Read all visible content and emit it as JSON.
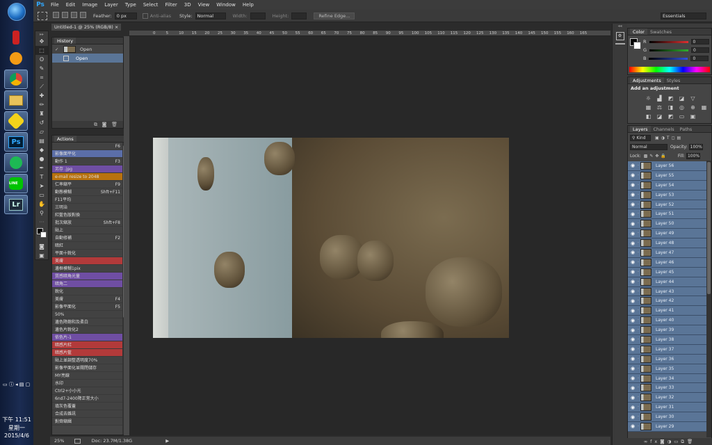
{
  "app": {
    "logo": "Ps"
  },
  "menu": [
    "File",
    "Edit",
    "Image",
    "Layer",
    "Type",
    "Select",
    "Filter",
    "3D",
    "View",
    "Window",
    "Help"
  ],
  "options": {
    "feather_label": "Feather:",
    "feather_value": "0 px",
    "antialias": "Anti-alias",
    "style_label": "Style:",
    "style_value": "Normal",
    "width_label": "Width:",
    "height_label": "Height:",
    "refine": "Refine Edge...",
    "workspace": "Essentials"
  },
  "document": {
    "tab": "Untitled-1 @ 25% (RGB/8)",
    "zoom": "25%",
    "doc_size": "Doc: 23.7M/1.38G"
  },
  "ruler_ticks": [
    "0",
    "5",
    "10",
    "15",
    "20",
    "25",
    "30",
    "35",
    "40",
    "45",
    "50",
    "55",
    "60",
    "65",
    "70",
    "75",
    "80",
    "85",
    "90",
    "95",
    "100",
    "105",
    "110",
    "115",
    "120",
    "125",
    "130",
    "135",
    "140",
    "145",
    "150",
    "155",
    "160",
    "165"
  ],
  "history": {
    "title": "History",
    "snapshot": "Open",
    "item": "Open"
  },
  "actions": {
    "title": "Actions",
    "items": [
      {
        "label": "",
        "key": "F6",
        "color": "plain"
      },
      {
        "label": "影像面平化",
        "key": "",
        "color": "blue"
      },
      {
        "label": "動作 1",
        "key": "F3",
        "color": "plain"
      },
      {
        "label": "另存 .jpg",
        "key": "",
        "color": "purple"
      },
      {
        "label": "e-mail resize to 2048",
        "key": "",
        "color": "orange"
      },
      {
        "label": "仁率縮平",
        "key": "F9",
        "color": "plain"
      },
      {
        "label": "動態模糊",
        "key": "Shft+F11",
        "color": "plain"
      },
      {
        "label": "F11平均",
        "key": "",
        "color": "plain"
      },
      {
        "label": "三明治",
        "key": "",
        "color": "plain"
      },
      {
        "label": "紅藍色版對換",
        "key": "",
        "color": "plain"
      },
      {
        "label": "批次縮放",
        "key": "Shft+F8",
        "color": "plain"
      },
      {
        "label": "貼上",
        "key": "",
        "color": "plain"
      },
      {
        "label": "自動修補",
        "key": "F2",
        "color": "plain"
      },
      {
        "label": "暗紅",
        "key": "",
        "color": "plain"
      },
      {
        "label": "平面十銳化",
        "key": "",
        "color": "plain"
      },
      {
        "label": "美膚",
        "key": "",
        "color": "red"
      },
      {
        "label": "邊框模糊1pix",
        "key": "",
        "color": "plain"
      },
      {
        "label": "質感暗角光量",
        "key": "",
        "color": "purple"
      },
      {
        "label": "暗角二",
        "key": "",
        "color": "purple"
      },
      {
        "label": "銳化",
        "key": "",
        "color": "plain"
      },
      {
        "label": "美膚",
        "key": "F4",
        "color": "plain"
      },
      {
        "label": "影像平面化",
        "key": "F5",
        "color": "plain"
      },
      {
        "label": "50%",
        "key": "",
        "color": "plain"
      },
      {
        "label": "邊色降飽和及柔白",
        "key": "",
        "color": "plain"
      },
      {
        "label": "邊色片銳化2",
        "key": "",
        "color": "plain"
      },
      {
        "label": "依色片-1",
        "key": "",
        "color": "purple"
      },
      {
        "label": "暗感片紅",
        "key": "",
        "color": "red"
      },
      {
        "label": "暗感片藍",
        "key": "",
        "color": "red"
      },
      {
        "label": "貼上並調整透明度70%",
        "key": "",
        "color": "plain"
      },
      {
        "label": "影像平面化並關閉儲存",
        "key": "",
        "color": "plain"
      },
      {
        "label": "MY亮線",
        "key": "",
        "color": "plain"
      },
      {
        "label": "水印",
        "key": "",
        "color": "plain"
      },
      {
        "label": "Ctrl2+小小光",
        "key": "",
        "color": "plain"
      },
      {
        "label": "6nd7-2400降正常大小",
        "key": "",
        "color": "plain"
      },
      {
        "label": "填灰色覆蓋",
        "key": "",
        "color": "plain"
      },
      {
        "label": "合成去雜訊",
        "key": "",
        "color": "plain"
      },
      {
        "label": "對齊縮緝",
        "key": "",
        "color": "plain"
      }
    ]
  },
  "color_panel": {
    "tabs": [
      "Color",
      "Swatches"
    ],
    "channels": [
      {
        "name": "R",
        "value": "0",
        "color": "#e03030"
      },
      {
        "name": "G",
        "value": "0",
        "color": "#30b030"
      },
      {
        "name": "B",
        "value": "0",
        "color": "#3050e0"
      }
    ]
  },
  "adjustments": {
    "tabs": [
      "Adjustments",
      "Styles"
    ],
    "heading": "Add an adjustment"
  },
  "layers": {
    "tabs": [
      "Layers",
      "Channels",
      "Paths"
    ],
    "kind": "Kind",
    "blend": "Normal",
    "opacity_label": "Opacity:",
    "opacity": "100%",
    "lock_label": "Lock:",
    "fill_label": "Fill:",
    "fill": "100%",
    "items": [
      "Layer 56",
      "Layer 55",
      "Layer 54",
      "Layer 53",
      "Layer 52",
      "Layer 51",
      "Layer 50",
      "Layer 49",
      "Layer 48",
      "Layer 47",
      "Layer 46",
      "Layer 45",
      "Layer 44",
      "Layer 43",
      "Layer 42",
      "Layer 41",
      "Layer 40",
      "Layer 39",
      "Layer 38",
      "Layer 37",
      "Layer 36",
      "Layer 35",
      "Layer 34",
      "Layer 33",
      "Layer 32",
      "Layer 31",
      "Layer 30",
      "Layer 29"
    ]
  },
  "taskbar": {
    "time": "下午 11:51",
    "weekday": "星期一",
    "date": "2015/4/6",
    "apps": [
      "Ps",
      "Lr"
    ]
  }
}
